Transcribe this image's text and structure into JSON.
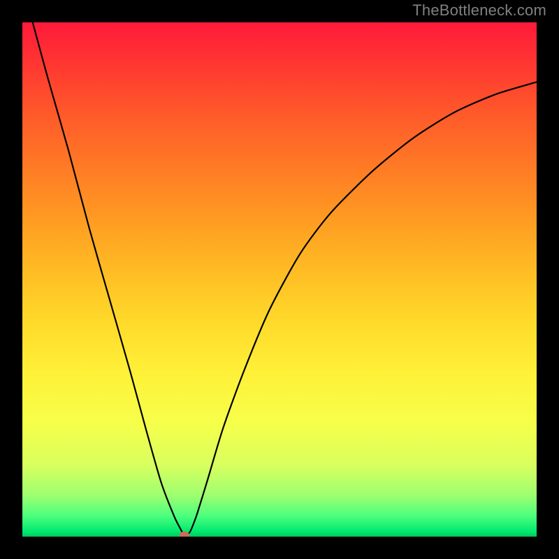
{
  "watermark": "TheBottleneck.com",
  "chart_data": {
    "type": "line",
    "title": "",
    "xlabel": "",
    "ylabel": "",
    "xlim": [
      0,
      100
    ],
    "ylim": [
      0,
      100
    ],
    "grid": false,
    "legend": false,
    "series": [
      {
        "name": "bottleneck-curve",
        "x": [
          2,
          5,
          9,
          13,
          17,
          21,
          24,
          27,
          29.5,
          30.8,
          31.3,
          31.7,
          32,
          32.5,
          33,
          34,
          36,
          39,
          43,
          48,
          54,
          60,
          68,
          76,
          84,
          92,
          100
        ],
        "y": [
          100,
          89,
          75,
          60,
          46,
          32,
          21,
          10.5,
          4,
          1.4,
          0.5,
          0.3,
          0.4,
          0.8,
          1.8,
          4.5,
          11,
          21,
          32,
          44,
          55,
          63,
          71,
          77.5,
          82.5,
          86,
          88.4
        ]
      }
    ],
    "marker": {
      "x": 31.5,
      "y": 0.3,
      "color": "#cf6a5a"
    },
    "background_gradient": [
      "#ff1a3a",
      "#00c75c"
    ]
  }
}
